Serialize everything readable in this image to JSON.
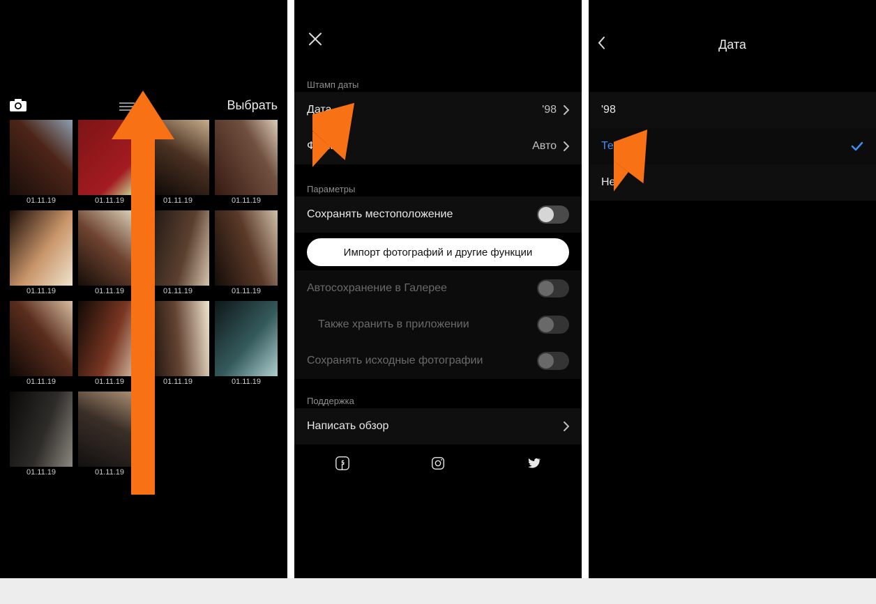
{
  "screen1": {
    "select_label": "Выбрать",
    "thumb_caption": "01.11.19",
    "grid_count": 14
  },
  "screen2": {
    "section_stamp": "Штамп даты",
    "row_date_label": "Дата",
    "row_date_value": "'98",
    "row_format_label": "Формат",
    "row_format_value": "Авто",
    "section_params": "Параметры",
    "row_save_location": "Сохранять местоположение",
    "import_button": "Импорт фотографий и другие функции",
    "row_autosave": "Автосохранение в Галерее",
    "row_store_in_app": "Также хранить в приложении",
    "row_save_originals": "Сохранять исходные фотографии",
    "section_support": "Поддержка",
    "row_review": "Написать обзор"
  },
  "screen3": {
    "title": "Дата",
    "opt_98": "'98",
    "opt_current": "Текущая",
    "opt_none": "Нет"
  },
  "arrow_color": "#f97115"
}
